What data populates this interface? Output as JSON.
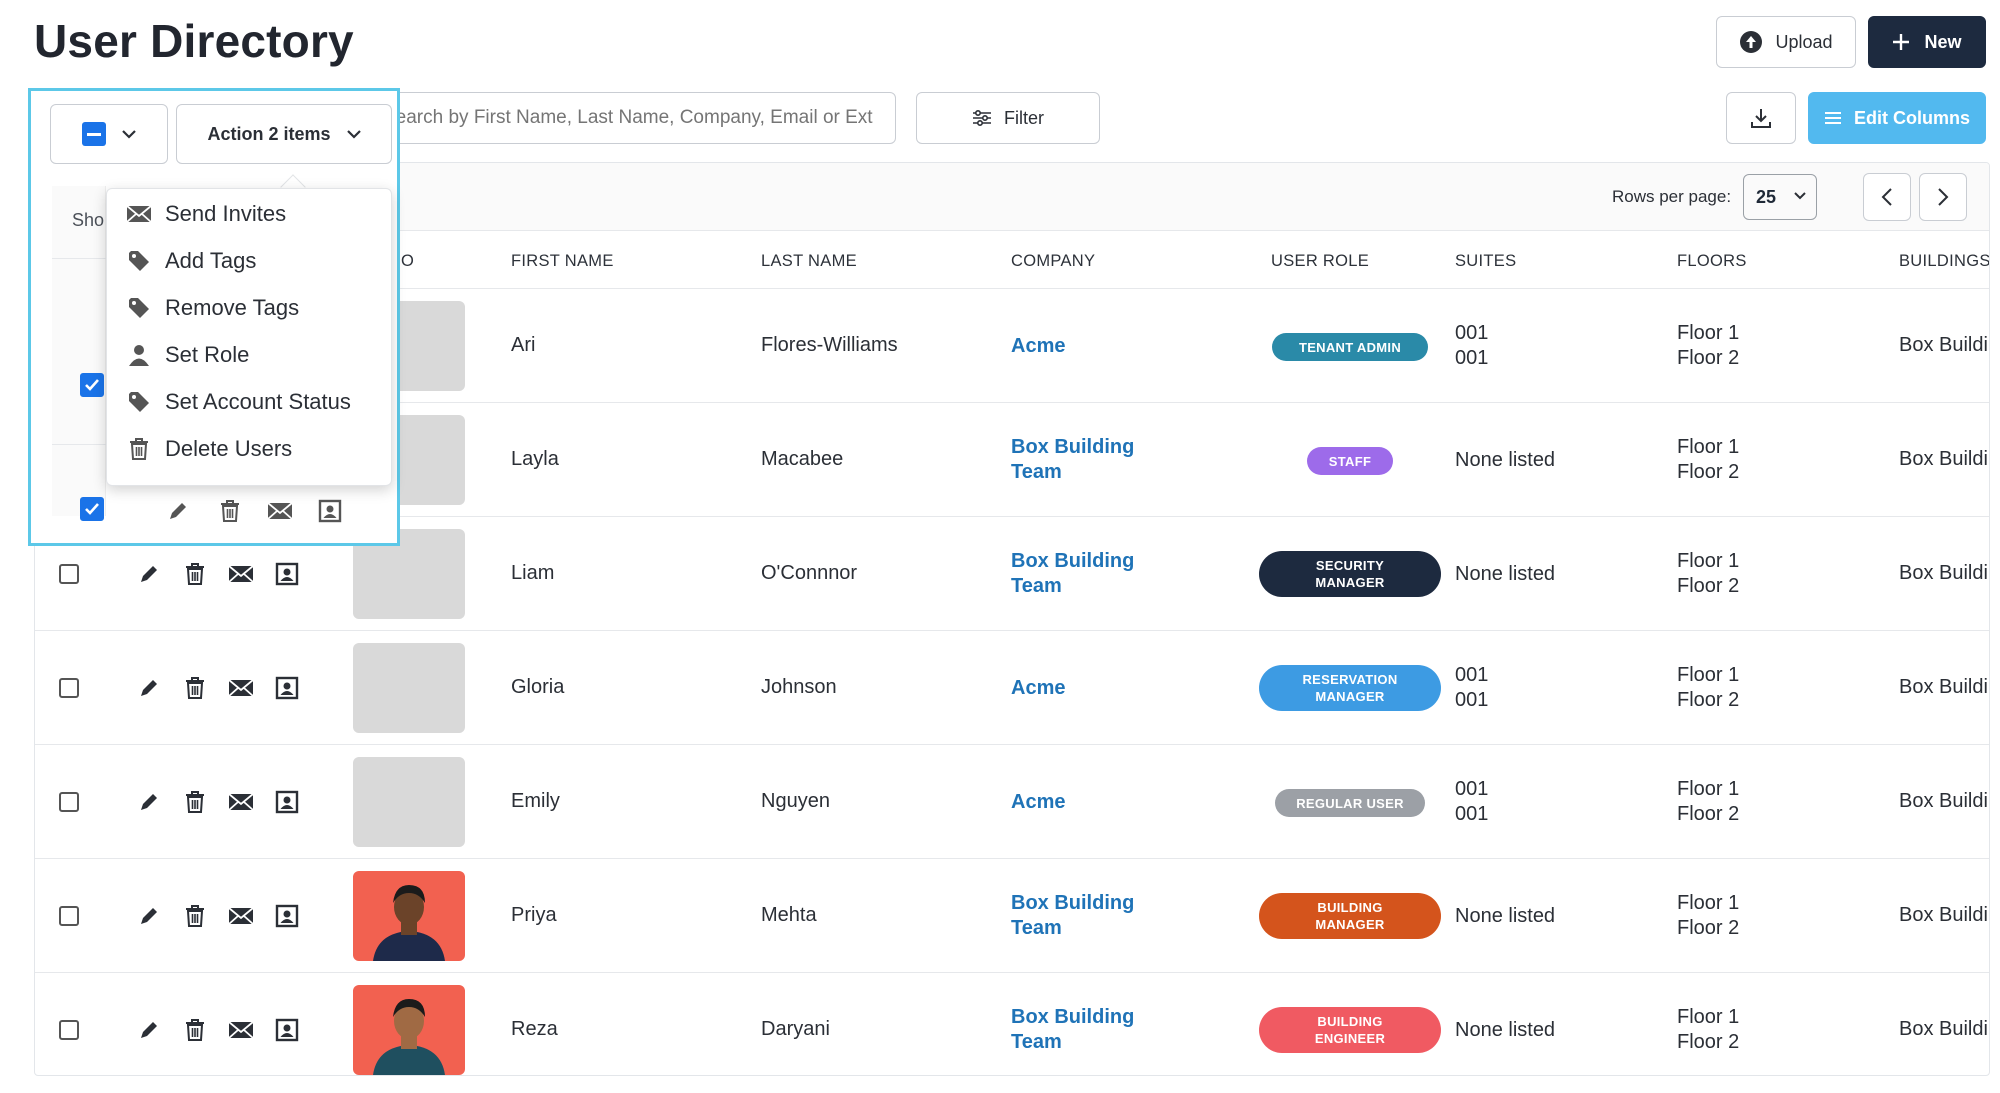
{
  "page": {
    "title": "User Directory"
  },
  "header": {
    "upload_label": "Upload",
    "new_label": "New"
  },
  "toolbar": {
    "action_label": "Action 2 items",
    "search_placeholder": "Search by First Name, Last Name, Company, Email or Ext",
    "filter_label": "Filter",
    "edit_columns_label": "Edit Columns",
    "show_label": "Sho"
  },
  "pagination": {
    "rows_per_page_label": "Rows per page:",
    "rows_per_page_value": "25"
  },
  "columns": [
    "O",
    "FIRST NAME",
    "LAST NAME",
    "COMPANY",
    "USER ROLE",
    "SUITES",
    "FLOORS",
    "BUILDINGS"
  ],
  "action_menu": {
    "items": [
      "Send Invites",
      "Add Tags",
      "Remove Tags",
      "Set Role",
      "Set Account Status",
      "Delete Users"
    ]
  },
  "colors": {
    "accent": "#1f73b7",
    "tenant_admin": "#2a8aa8",
    "staff": "#9d6bea",
    "security_manager": "#1d2a3f",
    "reservation_manager": "#3d9be3",
    "regular_user": "#9ca0a6",
    "building_manager": "#d4541c",
    "building_engineer": "#f05a62"
  },
  "rows": [
    {
      "first": "Ari",
      "last": "Flores-Williams",
      "company_1": "Acme",
      "company_2": "",
      "role_1": "TENANT ADMIN",
      "role_2": "",
      "suites_1": "001",
      "suites_2": "001",
      "floor_1": "Floor 1",
      "floor_2": "Floor 2",
      "building": "Box Buildi",
      "checked": true
    },
    {
      "first": "Layla",
      "last": "Macabee",
      "company_1": "Box Building",
      "company_2": "Team",
      "role_1": "STAFF",
      "role_2": "",
      "suites_1": "None listed",
      "suites_2": "",
      "floor_1": "Floor 1",
      "floor_2": "Floor 2",
      "building": "Box Buildi",
      "checked": true
    },
    {
      "first": "Liam",
      "last": "O'Connnor",
      "company_1": "Box Building",
      "company_2": "Team",
      "role_1": "SECURITY",
      "role_2": "MANAGER",
      "suites_1": "None listed",
      "suites_2": "",
      "floor_1": "Floor 1",
      "floor_2": "Floor 2",
      "building": "Box Buildi",
      "checked": false
    },
    {
      "first": "Gloria",
      "last": "Johnson",
      "company_1": "Acme",
      "company_2": "",
      "role_1": "RESERVATION",
      "role_2": "MANAGER",
      "suites_1": "001",
      "suites_2": "001",
      "floor_1": "Floor 1",
      "floor_2": "Floor 2",
      "building": "Box Buildi",
      "checked": false
    },
    {
      "first": "Emily",
      "last": "Nguyen",
      "company_1": "Acme",
      "company_2": "",
      "role_1": "REGULAR USER",
      "role_2": "",
      "suites_1": "001",
      "suites_2": "001",
      "floor_1": "Floor 1",
      "floor_2": "Floor 2",
      "building": "Box Buildi",
      "checked": false
    },
    {
      "first": "Priya",
      "last": "Mehta",
      "company_1": "Box Building",
      "company_2": "Team",
      "role_1": "BUILDING",
      "role_2": "MANAGER",
      "suites_1": "None listed",
      "suites_2": "",
      "floor_1": "Floor 1",
      "floor_2": "Floor 2",
      "building": "Box Buildi",
      "checked": false
    },
    {
      "first": "Reza",
      "last": "Daryani",
      "company_1": "Box Building",
      "company_2": "Team",
      "role_1": "BUILDING",
      "role_2": "ENGINEER",
      "suites_1": "None listed",
      "suites_2": "",
      "floor_1": "Floor 1",
      "floor_2": "Floor 2",
      "building": "Box Buildi",
      "checked": false
    }
  ]
}
